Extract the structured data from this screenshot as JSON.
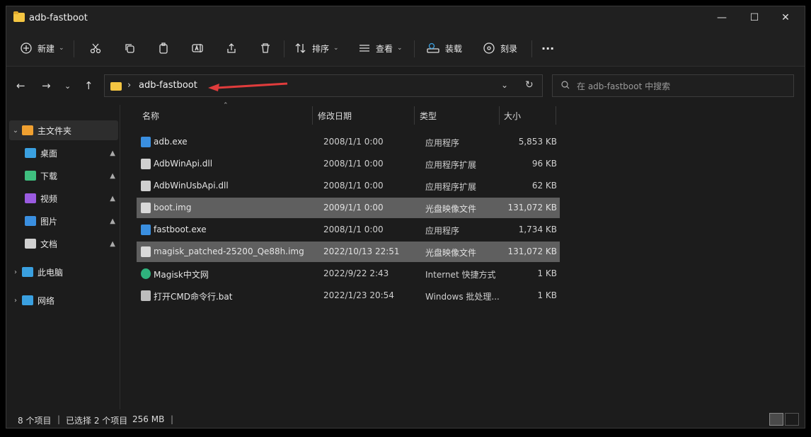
{
  "window": {
    "title": "adb-fastboot"
  },
  "toolbar": {
    "new_label": "新建",
    "sort_label": "排序",
    "view_label": "查看",
    "mount_label": "装载",
    "burn_label": "刻录"
  },
  "address": {
    "path": "adb-fastboot",
    "separator": "›"
  },
  "search": {
    "placeholder": "在 adb-fastboot 中搜索"
  },
  "sidebar": {
    "items": [
      {
        "label": "主文件夹",
        "icon": "home-icon",
        "color": "#f0a030"
      },
      {
        "label": "桌面",
        "icon": "desktop-icon",
        "color": "#3aa0e0"
      },
      {
        "label": "下载",
        "icon": "download-icon",
        "color": "#3fbf7f"
      },
      {
        "label": "视频",
        "icon": "video-icon",
        "color": "#9a5be0"
      },
      {
        "label": "图片",
        "icon": "picture-icon",
        "color": "#3a8fe0"
      },
      {
        "label": "文档",
        "icon": "document-icon",
        "color": "#d0d0d0"
      },
      {
        "label": "此电脑",
        "icon": "computer-icon",
        "color": "#3aa0e0"
      },
      {
        "label": "网络",
        "icon": "network-icon",
        "color": "#3aa0e0"
      }
    ]
  },
  "columns": {
    "name": "名称",
    "modified": "修改日期",
    "type": "类型",
    "size": "大小"
  },
  "files": [
    {
      "name": "adb.exe",
      "modified": "2008/1/1 0:00",
      "type": "应用程序",
      "size": "5,853 KB",
      "icon": "exe-icon",
      "selected": false
    },
    {
      "name": "AdbWinApi.dll",
      "modified": "2008/1/1 0:00",
      "type": "应用程序扩展",
      "size": "96 KB",
      "icon": "dll-icon",
      "selected": false
    },
    {
      "name": "AdbWinUsbApi.dll",
      "modified": "2008/1/1 0:00",
      "type": "应用程序扩展",
      "size": "62 KB",
      "icon": "dll-icon",
      "selected": false
    },
    {
      "name": "boot.img",
      "modified": "2009/1/1 0:00",
      "type": "光盘映像文件",
      "size": "131,072 KB",
      "icon": "disc-image-icon",
      "selected": true
    },
    {
      "name": "fastboot.exe",
      "modified": "2008/1/1 0:00",
      "type": "应用程序",
      "size": "1,734 KB",
      "icon": "exe-icon",
      "selected": false
    },
    {
      "name": "magisk_patched-25200_Qe88h.img",
      "modified": "2022/10/13 22:51",
      "type": "光盘映像文件",
      "size": "131,072 KB",
      "icon": "disc-image-icon",
      "selected": true
    },
    {
      "name": "Magisk中文网",
      "modified": "2022/9/22 2:43",
      "type": "Internet 快捷方式",
      "size": "1 KB",
      "icon": "edge-icon",
      "selected": false
    },
    {
      "name": "打开CMD命令行.bat",
      "modified": "2022/1/23 20:54",
      "type": "Windows 批处理...",
      "size": "1 KB",
      "icon": "bat-icon",
      "selected": false
    }
  ],
  "status": {
    "count": "8 个项目",
    "selected": "已选择 2 个项目",
    "size": "256 MB",
    "sep": "|"
  },
  "colors": {
    "accent_arrow": "#e03c3c",
    "selection": "#5f5f5f",
    "folder": "#f4c542"
  }
}
